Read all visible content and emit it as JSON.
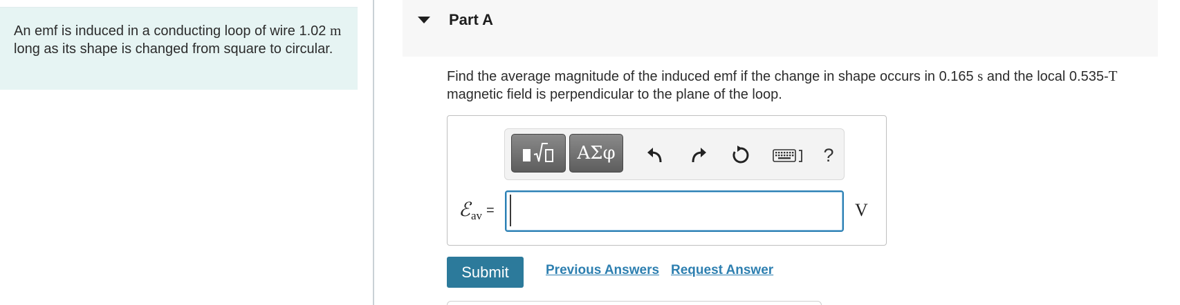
{
  "problem": {
    "text_part1": "An emf is induced in a conducting loop of wire 1.02 ",
    "unit_m": "m",
    "text_part2": " long as its shape is changed from square to circular."
  },
  "part": {
    "title": "Part A"
  },
  "question": {
    "part1": "Find the average magnitude of the induced emf if the change in shape occurs in 0.165 ",
    "unit_s": "s",
    "part2": " and the local 0.535-",
    "unit_T": "T",
    "part3": " magnetic field is perpendicular to the plane of the loop."
  },
  "toolbar": {
    "templates_icon": "fraction-sqrt-templates-icon",
    "greek_label": "ΑΣφ",
    "undo_icon": "undo-icon",
    "redo_icon": "redo-icon",
    "reset_icon": "reset-icon",
    "keyboard_icon": "keyboard-icon",
    "help_label": "?"
  },
  "answer": {
    "symbol": "ℰ",
    "subscript": "av",
    "equals": "=",
    "value": "",
    "unit": "V"
  },
  "actions": {
    "submit_label": "Submit",
    "previous_answers_label": "Previous Answers",
    "request_answer_label": "Request Answer"
  },
  "colors": {
    "problem_bg": "#e6f4f3",
    "submit_bg": "#2c7a9b",
    "link": "#2d7fb0",
    "input_border": "#2a7fb3"
  }
}
